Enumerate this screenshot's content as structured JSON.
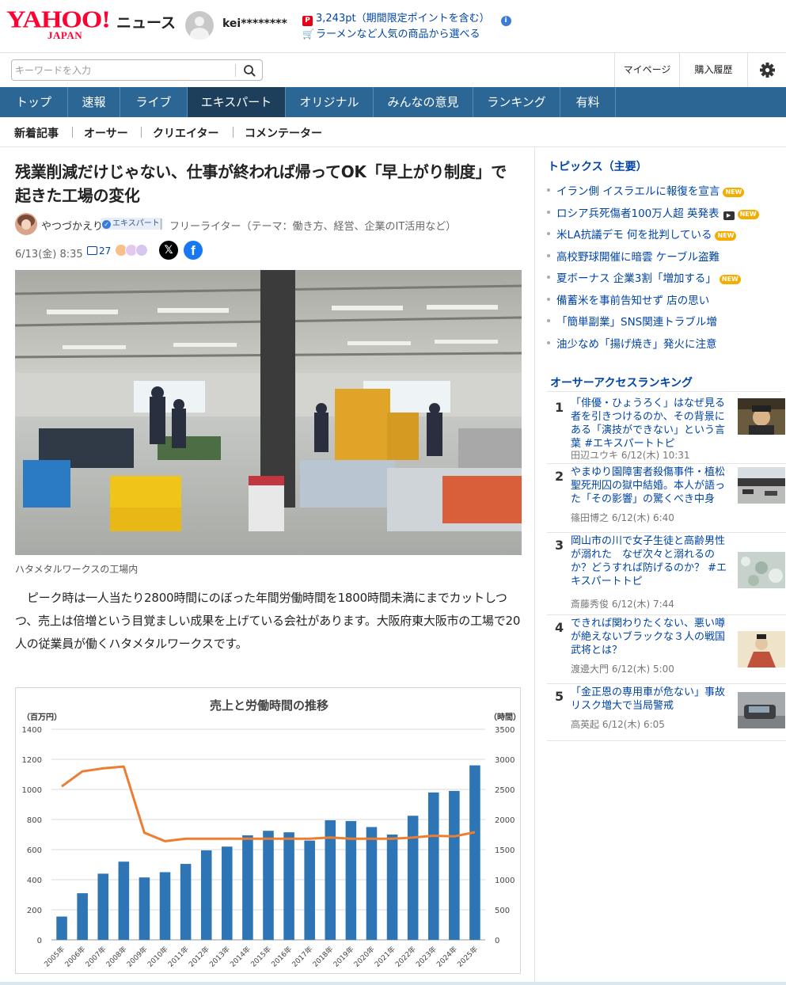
{
  "header": {
    "logo_text": "YAHOO!",
    "logo_sub": "JAPAN",
    "service_name": "ニュース",
    "username": "kei********",
    "points_text": "3,243pt（期間限定ポイントを含む）",
    "promo_text": "ラーメンなど人気の商品から選べる"
  },
  "search": {
    "placeholder": "キーワードを入力"
  },
  "header_links": {
    "mypage": "マイページ",
    "history": "購入履歴"
  },
  "nav": {
    "tabs": [
      {
        "label": "トップ"
      },
      {
        "label": "速報"
      },
      {
        "label": "ライブ"
      },
      {
        "label": "エキスパート",
        "active": true
      },
      {
        "label": "オリジナル"
      },
      {
        "label": "みんなの意見"
      },
      {
        "label": "ランキング"
      },
      {
        "label": "有料"
      }
    ]
  },
  "subnav": {
    "items": [
      "新着記事",
      "オーサー",
      "クリエイター",
      "コメンテーター"
    ]
  },
  "article": {
    "headline": "残業削減だけじゃない、仕事が終われば帰ってOK「早上がり制度」で起きた工場の変化",
    "author_name": "やつづかえり",
    "expert_label": "エキスパート",
    "author_description": "フリーライター（テーマ：働き方、経営、企業のIT活用など）",
    "date": "6/13(金) 8:35",
    "comment_count": "27",
    "photo_caption": "ハタメタルワークスの工場内",
    "body": "ピーク時は一人当たり2800時間にのぼった年間労働時間を1800時間未満にまでカットしつつ、売上は倍増という目覚ましい成果を上げている会社があります。大阪府東大阪市の工場で20人の従業員が働くハタメタルワークスです。"
  },
  "colors": {
    "brand_red": "#ff0033",
    "nav_blue": "#2b6694",
    "nav_active": "#1d3f5c",
    "link_blue": "#0044a6",
    "bar_blue": "#2e75b6",
    "line_orange": "#ed7d31",
    "new_badge": "#f6ab00"
  },
  "chart_data": {
    "type": "bar",
    "title": "売上と労働時間の推移",
    "ylabel_left": "（百万円）",
    "ylabel_right": "（時間）",
    "ylim_left": [
      0,
      1400
    ],
    "ylim_right": [
      0,
      3500
    ],
    "yticks_left": [
      0,
      200,
      400,
      600,
      800,
      1000,
      1200,
      1400
    ],
    "yticks_right": [
      0,
      500,
      1000,
      1500,
      2000,
      2500,
      3000,
      3500
    ],
    "categories": [
      "2005年",
      "2006年",
      "2007年",
      "2008年",
      "2009年",
      "2010年",
      "2011年",
      "2012年",
      "2013年",
      "2014年",
      "2015年",
      "2016年",
      "2017年",
      "2018年",
      "2019年",
      "2020年",
      "2021年",
      "2022年",
      "2023年",
      "2024年",
      "2025年"
    ],
    "series": [
      {
        "type": "bar",
        "axis": "left",
        "values": [
          155,
          310,
          440,
          520,
          415,
          450,
          505,
          595,
          620,
          695,
          725,
          715,
          660,
          795,
          790,
          750,
          700,
          825,
          980,
          990,
          1160
        ]
      },
      {
        "type": "line",
        "axis": "right",
        "values": [
          2550,
          2800,
          2850,
          2880,
          1780,
          1640,
          1680,
          1680,
          1680,
          1680,
          1680,
          1680,
          1680,
          1700,
          1680,
          1680,
          1680,
          1700,
          1730,
          1720,
          1790
        ]
      }
    ],
    "grid": true
  },
  "sidebar": {
    "topics_title": "トピックス（主要）",
    "new_label": "NEW",
    "topics": [
      {
        "title": "イラン側 イスラエルに報復を宣言",
        "new": true,
        "video": false
      },
      {
        "title": "ロシア兵死傷者100万人超 英発表",
        "new": true,
        "video": true
      },
      {
        "title": "米LA抗議デモ 何を批判している",
        "new": true,
        "video": false
      },
      {
        "title": "高校野球開催に暗雲 ケーブル盗難",
        "new": false,
        "video": false
      },
      {
        "title": "夏ボーナス 企業3割「増加する」",
        "new": true,
        "video": false
      },
      {
        "title": "備蓄米を事前告知せず 店の思い",
        "new": false,
        "video": false
      },
      {
        "title": "「簡単副業」SNS関連トラブル増",
        "new": false,
        "video": false
      },
      {
        "title": "油少なめ「揚げ焼き」発火に注意",
        "new": false,
        "video": false
      }
    ],
    "ranking_title": "オーサーアクセスランキング",
    "ranking": [
      {
        "rank": "1",
        "title": "「俳優・ひょうろく」はなぜ見る者を引きつけるのか、その背景にある「演技ができない」という言葉 #エキスパートトピ",
        "author": "田辺ユウキ",
        "date": "6/12(木) 10:31"
      },
      {
        "rank": "2",
        "title": "やまゆり園障害者殺傷事件・植松聖死刑囚の獄中結婚。本人が語った「その影響」の驚くべき中身",
        "author": "篠田博之",
        "date": "6/12(木) 6:40"
      },
      {
        "rank": "3",
        "title": "岡山市の川で女子生徒と高齢男性が溺れた　なぜ次々と溺れるのか？どうすれば防げるのか？ #エキスパートトピ",
        "author": "斎藤秀俊",
        "date": "6/12(木) 7:44"
      },
      {
        "rank": "4",
        "title": "できれば関わりたくない、悪い噂が絶えないブラックな３人の戦国武将とは？",
        "author": "渡邊大門",
        "date": "6/12(木) 5:00"
      },
      {
        "rank": "5",
        "title": "「金正恩の専用車が危ない」事故リスク増大で当局警戒",
        "author": "高英起",
        "date": "6/12(木) 6:05"
      }
    ]
  }
}
